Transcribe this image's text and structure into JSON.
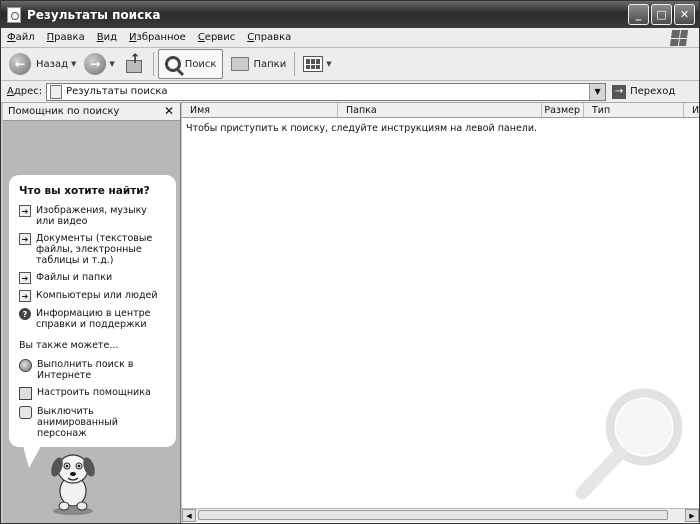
{
  "window": {
    "title": "Результаты поиска",
    "controls": [
      "_",
      "□",
      "✕"
    ]
  },
  "menu": [
    "Файл",
    "Правка",
    "Вид",
    "Избранное",
    "Сервис",
    "Справка"
  ],
  "toolbar": {
    "back_label": "Назад",
    "search_label": "Поиск",
    "folders_label": "Папки"
  },
  "address": {
    "label": "Адрес:",
    "value": "Результаты поиска",
    "go_label": "Переход"
  },
  "assistant": {
    "header": "Помощник по поиску",
    "question": "Что вы хотите найти?",
    "options": [
      "Изображения, музыку или видео",
      "Документы (текстовые файлы, электронные таблицы и т.д.)",
      "Файлы и папки",
      "Компьютеры или людей",
      "Информацию в центре справки и поддержки"
    ],
    "also_label": "Вы также можете...",
    "extra_options": [
      "Выполнить поиск в Интернете",
      "Настроить помощника",
      "Выключить анимированный персонаж"
    ]
  },
  "results": {
    "columns": [
      "Имя",
      "Папка",
      "Размер",
      "Тип",
      "И"
    ],
    "hint": "Чтобы приступить к поиску, следуйте инструкциям на левой панели."
  },
  "icons": {
    "back": "back-arrow-icon",
    "forward": "forward-arrow-icon",
    "up": "folder-up-icon",
    "search": "magnifier-icon",
    "folders": "folders-icon",
    "views": "views-icon"
  }
}
